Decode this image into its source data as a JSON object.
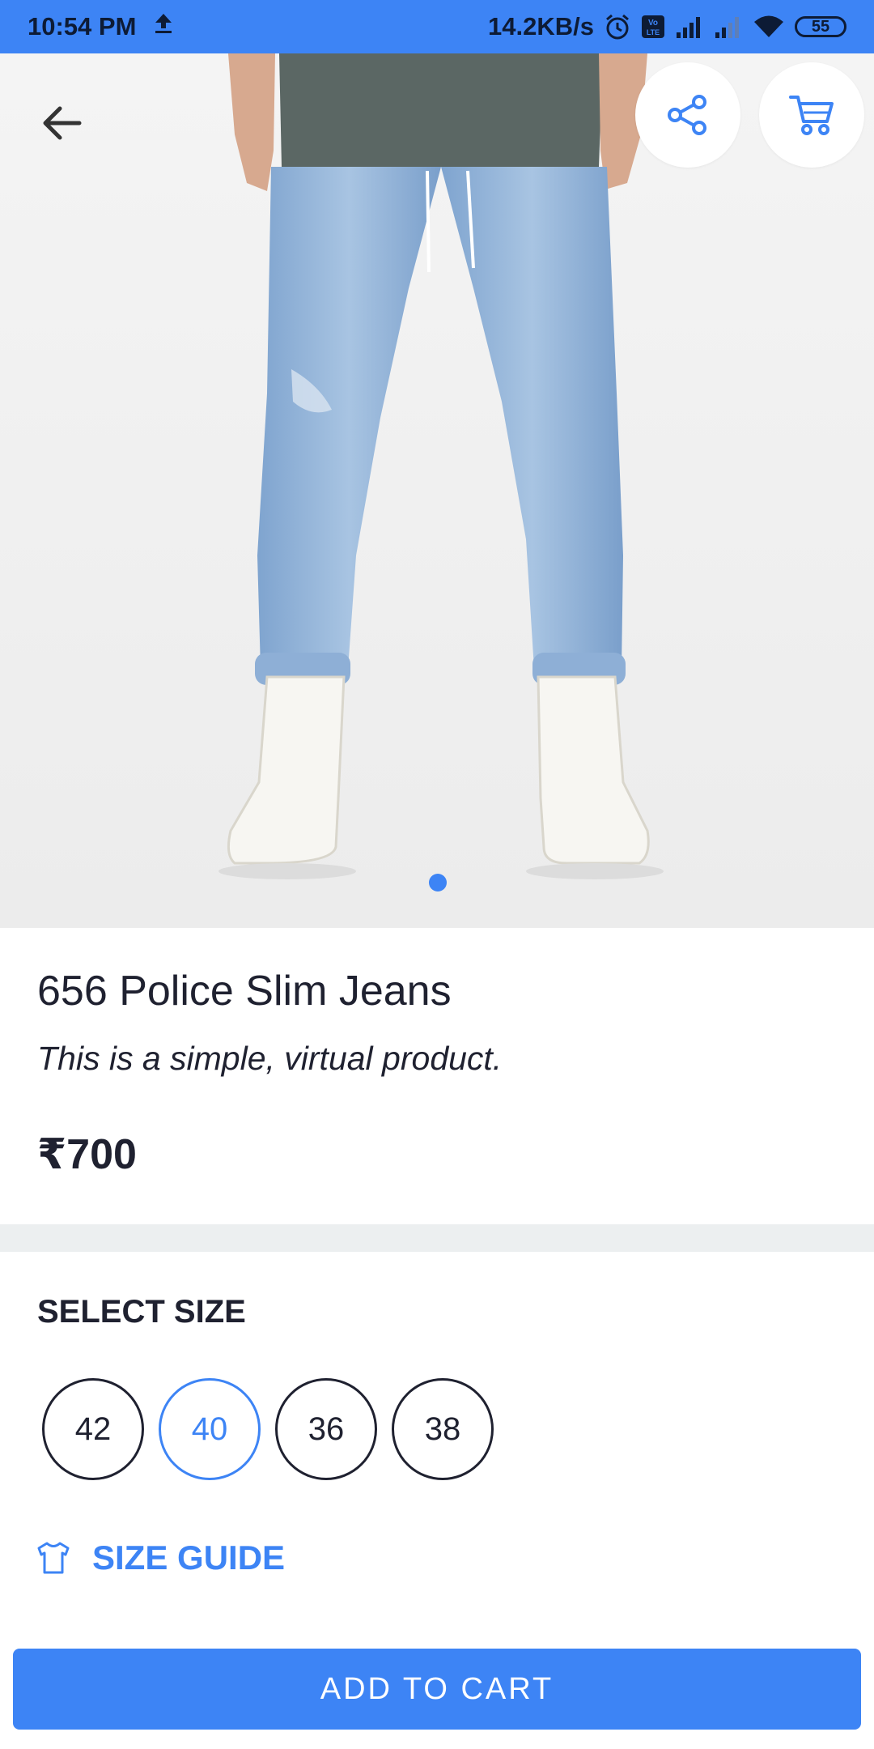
{
  "status_bar": {
    "time": "10:54 PM",
    "network_speed": "14.2KB/s",
    "battery": "55",
    "icons": [
      "upload-icon",
      "alarm-icon",
      "volte-icon",
      "signal-icon",
      "signal-icon",
      "wifi-icon",
      "battery-icon"
    ]
  },
  "header": {
    "back_icon": "arrow-left-icon",
    "share_icon": "share-icon",
    "cart_icon": "cart-icon"
  },
  "carousel": {
    "current_index": 1,
    "total": 1
  },
  "product": {
    "title": "656 Police Slim Jeans",
    "subtitle": "This is a simple, virtual product.",
    "price": "₹700"
  },
  "size_section": {
    "heading": "SELECT SIZE",
    "sizes": [
      "42",
      "40",
      "36",
      "38"
    ],
    "selected": "40",
    "guide_label": "SIZE GUIDE",
    "guide_icon": "tshirt-icon"
  },
  "actions": {
    "add_to_cart": "ADD TO CART"
  },
  "colors": {
    "accent": "#3d84f5",
    "text": "#1f2130",
    "divider": "#eceff0"
  }
}
